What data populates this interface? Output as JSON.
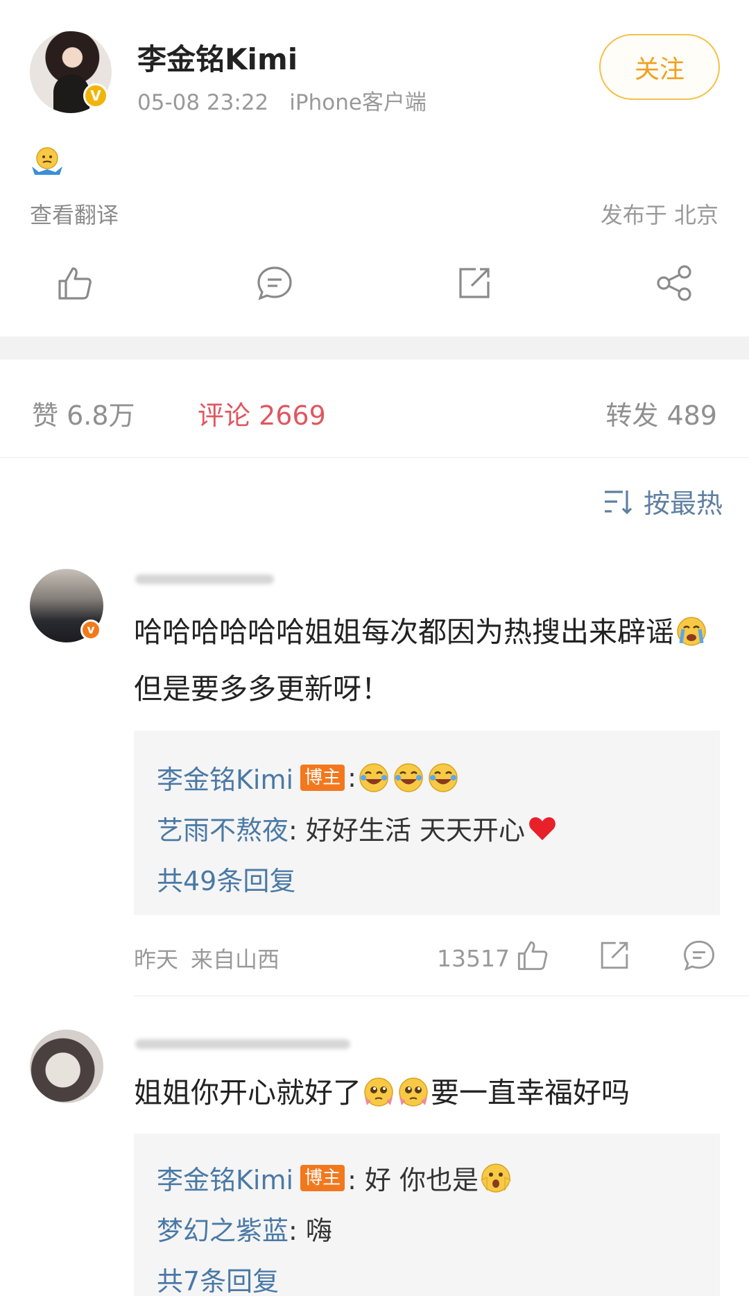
{
  "post": {
    "author_name": "李金铭Kimi",
    "verified_badge": "V",
    "time": "05-08 23:22",
    "source": "iPhone客户端",
    "follow_label": "关注",
    "content_emoji": "shrug-emoji",
    "translate_label": "查看翻译",
    "location": "发布于 北京",
    "actions": [
      "like-icon",
      "comment-icon",
      "repost-icon",
      "share-icon"
    ]
  },
  "stats": {
    "likes": "赞 6.8万",
    "comments": "评论 2669",
    "reposts": "转发 489"
  },
  "sort": {
    "label": "按最热"
  },
  "comments": [
    {
      "text_part1": "哈哈哈哈哈哈姐姐每次都因为热搜出来辟谣",
      "text_part2": "但是要多多更新呀！",
      "replies": [
        {
          "name": "李金铭Kimi",
          "tag": "博主",
          "text": ": "
        },
        {
          "name": "艺雨不熬夜",
          "text": " : 好好生活 天天开心"
        }
      ],
      "more_replies": "共49条回复",
      "time": "昨天",
      "location": "来自山西",
      "likes": "13517"
    },
    {
      "text_part1": "姐姐你开心就好了",
      "text_part2": "要一直幸福好吗",
      "replies": [
        {
          "name": "李金铭Kimi",
          "tag": "博主",
          "text": ": 好 你也是"
        },
        {
          "name": "梦幻之紫蓝",
          "text": " : 嗨"
        }
      ],
      "more_replies": "共7条回复"
    }
  ],
  "colors": {
    "accent_gold": "#f0a020",
    "comment_red": "#e0575f",
    "link_blue": "#4a79a6",
    "owner_tag": "#f2781e"
  }
}
